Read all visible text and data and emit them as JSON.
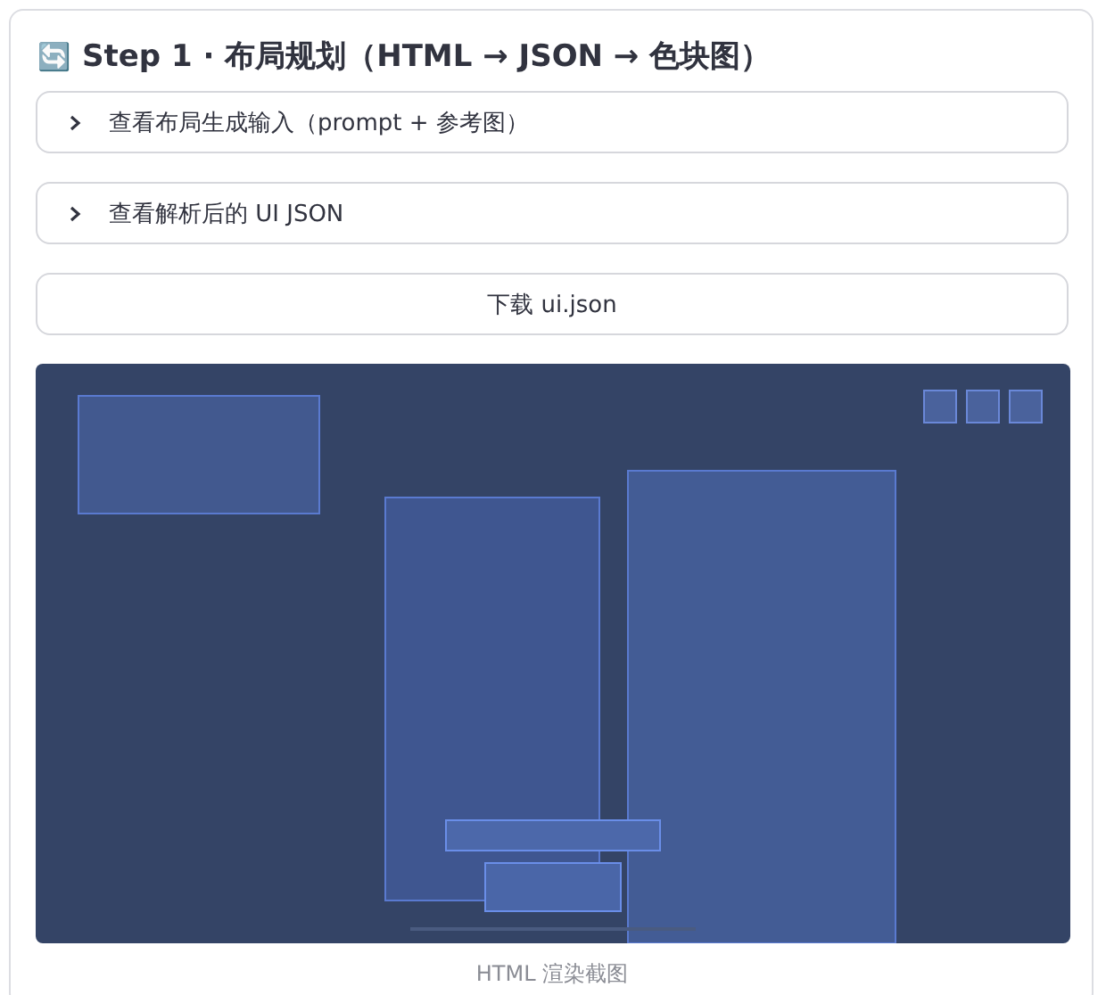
{
  "title": {
    "icon": "🔄",
    "text": "Step 1 · 布局规划（HTML → JSON → 色块图）"
  },
  "expanders": [
    {
      "label": "查看布局生成输入（prompt + 参考图）",
      "expanded": false
    },
    {
      "label": "查看解析后的 UI JSON",
      "expanded": false
    }
  ],
  "download_button": "下载 ui.json",
  "render": {
    "kind": "picture",
    "caption": "HTML 渲染截图"
  }
}
